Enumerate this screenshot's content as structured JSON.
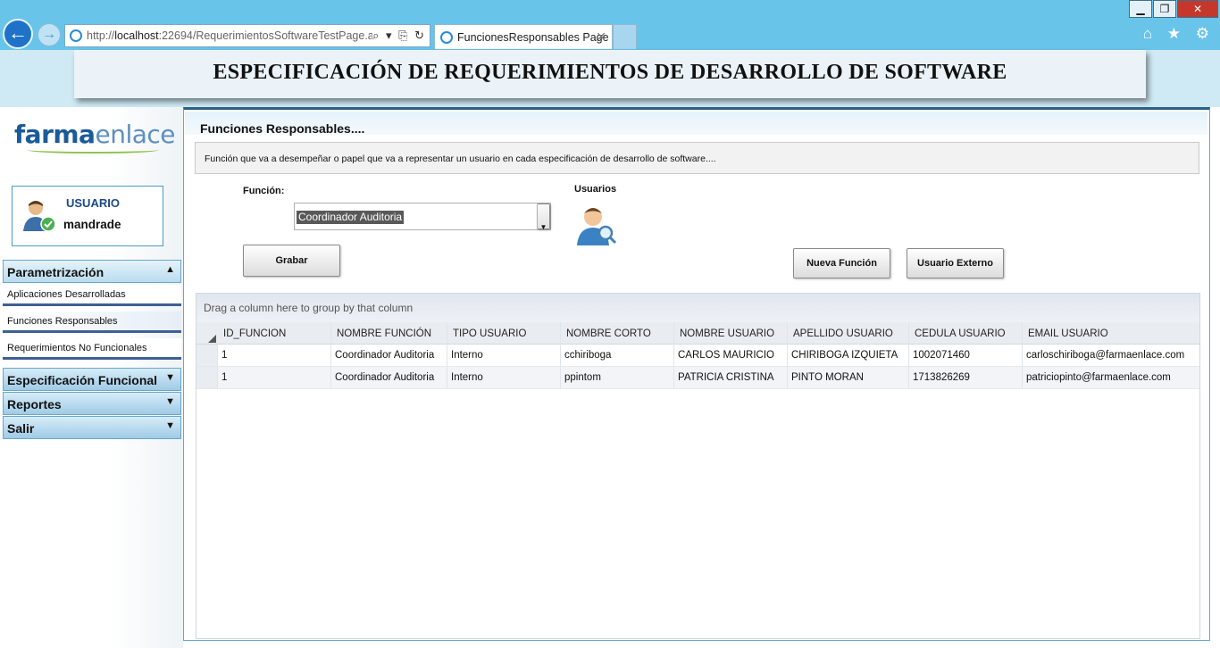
{
  "browser": {
    "url_prefix": "http://",
    "url_host": "localhost",
    "url_rest": ":22694/RequerimientosSoftwareTestPage.asp",
    "tab_title": "FuncionesResponsables Page",
    "addr_tools": "⌕ ▾ ⎘ ↻",
    "tab_close": "✕",
    "min_label": "▁",
    "restore_label": "❐",
    "close_label": "✕",
    "toolbar_icons": "⌂ ★ ⚙"
  },
  "header": {
    "title": "ESPECIFICACIÓN DE REQUERIMIENTOS DE DESARROLLO DE SOFTWARE"
  },
  "logo": {
    "part1": "farma",
    "part2": "enlace"
  },
  "user": {
    "label": "USUARIO",
    "name": "mandrade"
  },
  "menu": {
    "parametrizacion": "Parametrización",
    "items": [
      "Aplicaciones Desarrolladas",
      "Funciones Responsables",
      "Requerimientos No Funcionales"
    ],
    "especificacion": "Especificación Funcional",
    "reportes": "Reportes",
    "salir": "Salir",
    "chev_up": "▲",
    "chev_down": "▼"
  },
  "main": {
    "title": "Funciones Responsables....",
    "description": "Función que va a desempeñar o papel que va a representar un  usuario en cada especificación de desarrollo de software....",
    "funcion_label": "Función:",
    "funcion_value": "Coordinador Auditoria",
    "select_arrow": "▼",
    "usuarios_label": "Usuarios",
    "grabar": "Grabar",
    "nueva_funcion": "Nueva Función",
    "usuario_externo": "Usuario Externo"
  },
  "grid": {
    "group_hint": "Drag a column here to group by that column",
    "columns": [
      "ID_FUNCION",
      "NOMBRE FUNCIÓN",
      "TIPO USUARIO",
      "NOMBRE CORTO",
      "NOMBRE USUARIO",
      "APELLIDO USUARIO",
      "CEDULA USUARIO",
      "EMAIL USUARIO"
    ],
    "rows": [
      [
        "1",
        "Coordinador Auditoria",
        "Interno",
        "cchiriboga",
        "CARLOS MAURICIO",
        "CHIRIBOGA IZQUIETA",
        "1002071460",
        "carloschiriboga@farmaenlace.com"
      ],
      [
        "1",
        "Coordinador Auditoria",
        "Interno",
        "ppintom",
        "PATRICIA CRISTINA",
        "PINTO MORAN",
        "1713826269",
        "patriciopinto@farmaenlace.com"
      ]
    ]
  },
  "colors": {
    "chrome": "#69c4ea",
    "header_band": "#cfeaf5",
    "menu_border": "#6aa6cc",
    "menu_accent": "#3f5f96"
  }
}
